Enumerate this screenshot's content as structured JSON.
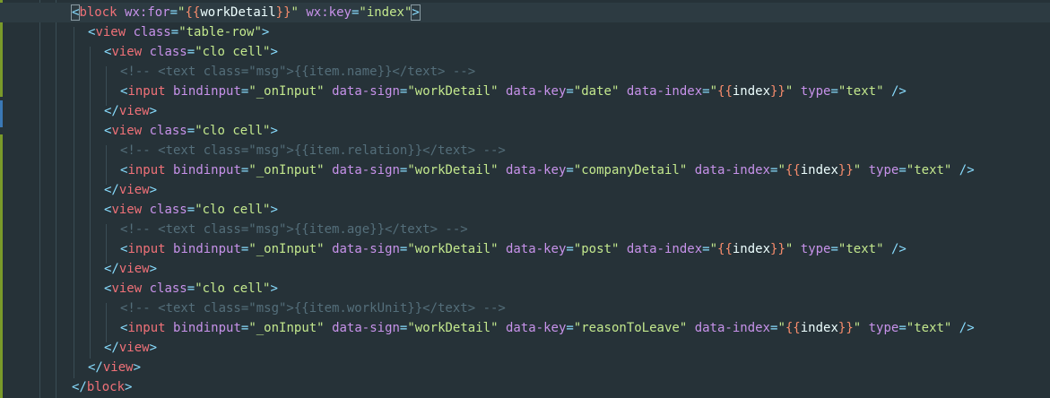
{
  "lines": [
    {
      "indent": 80,
      "active": true,
      "tokens": [
        {
          "t": "<",
          "c": "tk-punc",
          "box": true
        },
        {
          "t": "block",
          "c": "tk-tag"
        },
        {
          "t": " ",
          "c": "tk-text"
        },
        {
          "t": "wx:for",
          "c": "tk-attr"
        },
        {
          "t": "=",
          "c": "tk-eq"
        },
        {
          "t": "\"",
          "c": "tk-str"
        },
        {
          "t": "{{",
          "c": "tk-mus"
        },
        {
          "t": "workDetail",
          "c": "tk-var"
        },
        {
          "t": "}}",
          "c": "tk-mus"
        },
        {
          "t": "\"",
          "c": "tk-str"
        },
        {
          "t": " ",
          "c": "tk-text"
        },
        {
          "t": "wx:key",
          "c": "tk-attr"
        },
        {
          "t": "=",
          "c": "tk-eq"
        },
        {
          "t": "\"index\"",
          "c": "tk-str"
        },
        {
          "t": ">",
          "c": "tk-punc",
          "box": true
        }
      ]
    },
    {
      "indent": 98,
      "tokens": [
        {
          "t": "<",
          "c": "tk-punc"
        },
        {
          "t": "view",
          "c": "tk-tag"
        },
        {
          "t": " ",
          "c": "tk-text"
        },
        {
          "t": "class",
          "c": "tk-attr"
        },
        {
          "t": "=",
          "c": "tk-eq"
        },
        {
          "t": "\"table-row\"",
          "c": "tk-str"
        },
        {
          "t": ">",
          "c": "tk-punc"
        }
      ]
    },
    {
      "indent": 116,
      "tokens": [
        {
          "t": "<",
          "c": "tk-punc"
        },
        {
          "t": "view",
          "c": "tk-tag"
        },
        {
          "t": " ",
          "c": "tk-text"
        },
        {
          "t": "class",
          "c": "tk-attr"
        },
        {
          "t": "=",
          "c": "tk-eq"
        },
        {
          "t": "\"clo cell\"",
          "c": "tk-str"
        },
        {
          "t": ">",
          "c": "tk-punc"
        }
      ]
    },
    {
      "indent": 134,
      "tokens": [
        {
          "t": "<!-- <text class=\"msg\">{{item.name}}</text> -->",
          "c": "tk-cmt"
        }
      ]
    },
    {
      "indent": 134,
      "tokens": [
        {
          "t": "<",
          "c": "tk-punc"
        },
        {
          "t": "input",
          "c": "tk-tag"
        },
        {
          "t": " ",
          "c": "tk-text"
        },
        {
          "t": "bindinput",
          "c": "tk-attr"
        },
        {
          "t": "=",
          "c": "tk-eq"
        },
        {
          "t": "\"_onInput\"",
          "c": "tk-str"
        },
        {
          "t": " ",
          "c": "tk-text"
        },
        {
          "t": "data-sign",
          "c": "tk-attr"
        },
        {
          "t": "=",
          "c": "tk-eq"
        },
        {
          "t": "\"workDetail\"",
          "c": "tk-str"
        },
        {
          "t": " ",
          "c": "tk-text"
        },
        {
          "t": "data-key",
          "c": "tk-attr"
        },
        {
          "t": "=",
          "c": "tk-eq"
        },
        {
          "t": "\"date\"",
          "c": "tk-str"
        },
        {
          "t": " ",
          "c": "tk-text"
        },
        {
          "t": "data-index",
          "c": "tk-attr"
        },
        {
          "t": "=",
          "c": "tk-eq"
        },
        {
          "t": "\"",
          "c": "tk-str"
        },
        {
          "t": "{{",
          "c": "tk-mus"
        },
        {
          "t": "index",
          "c": "tk-var"
        },
        {
          "t": "}}",
          "c": "tk-mus"
        },
        {
          "t": "\"",
          "c": "tk-str"
        },
        {
          "t": " ",
          "c": "tk-text"
        },
        {
          "t": "type",
          "c": "tk-attr"
        },
        {
          "t": "=",
          "c": "tk-eq"
        },
        {
          "t": "\"text\"",
          "c": "tk-str"
        },
        {
          "t": " ",
          "c": "tk-text"
        },
        {
          "t": "/>",
          "c": "tk-punc"
        }
      ]
    },
    {
      "indent": 116,
      "tokens": [
        {
          "t": "</",
          "c": "tk-punc"
        },
        {
          "t": "view",
          "c": "tk-tag"
        },
        {
          "t": ">",
          "c": "tk-punc"
        }
      ]
    },
    {
      "indent": 116,
      "tokens": [
        {
          "t": "<",
          "c": "tk-punc"
        },
        {
          "t": "view",
          "c": "tk-tag"
        },
        {
          "t": " ",
          "c": "tk-text"
        },
        {
          "t": "class",
          "c": "tk-attr"
        },
        {
          "t": "=",
          "c": "tk-eq"
        },
        {
          "t": "\"clo cell\"",
          "c": "tk-str"
        },
        {
          "t": ">",
          "c": "tk-punc"
        }
      ]
    },
    {
      "indent": 134,
      "tokens": [
        {
          "t": "<!-- <text class=\"msg\">{{item.relation}}</text> -->",
          "c": "tk-cmt"
        }
      ]
    },
    {
      "indent": 134,
      "tokens": [
        {
          "t": "<",
          "c": "tk-punc"
        },
        {
          "t": "input",
          "c": "tk-tag"
        },
        {
          "t": " ",
          "c": "tk-text"
        },
        {
          "t": "bindinput",
          "c": "tk-attr"
        },
        {
          "t": "=",
          "c": "tk-eq"
        },
        {
          "t": "\"_onInput\"",
          "c": "tk-str"
        },
        {
          "t": " ",
          "c": "tk-text"
        },
        {
          "t": "data-sign",
          "c": "tk-attr"
        },
        {
          "t": "=",
          "c": "tk-eq"
        },
        {
          "t": "\"workDetail\"",
          "c": "tk-str"
        },
        {
          "t": " ",
          "c": "tk-text"
        },
        {
          "t": "data-key",
          "c": "tk-attr"
        },
        {
          "t": "=",
          "c": "tk-eq"
        },
        {
          "t": "\"companyDetail\"",
          "c": "tk-str"
        },
        {
          "t": " ",
          "c": "tk-text"
        },
        {
          "t": "data-index",
          "c": "tk-attr"
        },
        {
          "t": "=",
          "c": "tk-eq"
        },
        {
          "t": "\"",
          "c": "tk-str"
        },
        {
          "t": "{{",
          "c": "tk-mus"
        },
        {
          "t": "index",
          "c": "tk-var"
        },
        {
          "t": "}}",
          "c": "tk-mus"
        },
        {
          "t": "\"",
          "c": "tk-str"
        },
        {
          "t": " ",
          "c": "tk-text"
        },
        {
          "t": "type",
          "c": "tk-attr"
        },
        {
          "t": "=",
          "c": "tk-eq"
        },
        {
          "t": "\"text\"",
          "c": "tk-str"
        },
        {
          "t": " ",
          "c": "tk-text"
        },
        {
          "t": "/>",
          "c": "tk-punc"
        }
      ]
    },
    {
      "indent": 116,
      "tokens": [
        {
          "t": "</",
          "c": "tk-punc"
        },
        {
          "t": "view",
          "c": "tk-tag"
        },
        {
          "t": ">",
          "c": "tk-punc"
        }
      ]
    },
    {
      "indent": 116,
      "tokens": [
        {
          "t": "<",
          "c": "tk-punc"
        },
        {
          "t": "view",
          "c": "tk-tag"
        },
        {
          "t": " ",
          "c": "tk-text"
        },
        {
          "t": "class",
          "c": "tk-attr"
        },
        {
          "t": "=",
          "c": "tk-eq"
        },
        {
          "t": "\"clo cell\"",
          "c": "tk-str"
        },
        {
          "t": ">",
          "c": "tk-punc"
        }
      ]
    },
    {
      "indent": 134,
      "tokens": [
        {
          "t": "<!-- <text class=\"msg\">{{item.age}}</text> -->",
          "c": "tk-cmt"
        }
      ]
    },
    {
      "indent": 134,
      "tokens": [
        {
          "t": "<",
          "c": "tk-punc"
        },
        {
          "t": "input",
          "c": "tk-tag"
        },
        {
          "t": " ",
          "c": "tk-text"
        },
        {
          "t": "bindinput",
          "c": "tk-attr"
        },
        {
          "t": "=",
          "c": "tk-eq"
        },
        {
          "t": "\"_onInput\"",
          "c": "tk-str"
        },
        {
          "t": " ",
          "c": "tk-text"
        },
        {
          "t": "data-sign",
          "c": "tk-attr"
        },
        {
          "t": "=",
          "c": "tk-eq"
        },
        {
          "t": "\"workDetail\"",
          "c": "tk-str"
        },
        {
          "t": " ",
          "c": "tk-text"
        },
        {
          "t": "data-key",
          "c": "tk-attr"
        },
        {
          "t": "=",
          "c": "tk-eq"
        },
        {
          "t": "\"post\"",
          "c": "tk-str"
        },
        {
          "t": " ",
          "c": "tk-text"
        },
        {
          "t": "data-index",
          "c": "tk-attr"
        },
        {
          "t": "=",
          "c": "tk-eq"
        },
        {
          "t": "\"",
          "c": "tk-str"
        },
        {
          "t": "{{",
          "c": "tk-mus"
        },
        {
          "t": "index",
          "c": "tk-var"
        },
        {
          "t": "}}",
          "c": "tk-mus"
        },
        {
          "t": "\"",
          "c": "tk-str"
        },
        {
          "t": " ",
          "c": "tk-text"
        },
        {
          "t": "type",
          "c": "tk-attr"
        },
        {
          "t": "=",
          "c": "tk-eq"
        },
        {
          "t": "\"text\"",
          "c": "tk-str"
        },
        {
          "t": " ",
          "c": "tk-text"
        },
        {
          "t": "/>",
          "c": "tk-punc"
        }
      ]
    },
    {
      "indent": 116,
      "tokens": [
        {
          "t": "</",
          "c": "tk-punc"
        },
        {
          "t": "view",
          "c": "tk-tag"
        },
        {
          "t": ">",
          "c": "tk-punc"
        }
      ]
    },
    {
      "indent": 116,
      "tokens": [
        {
          "t": "<",
          "c": "tk-punc"
        },
        {
          "t": "view",
          "c": "tk-tag"
        },
        {
          "t": " ",
          "c": "tk-text"
        },
        {
          "t": "class",
          "c": "tk-attr"
        },
        {
          "t": "=",
          "c": "tk-eq"
        },
        {
          "t": "\"clo cell\"",
          "c": "tk-str"
        },
        {
          "t": ">",
          "c": "tk-punc"
        }
      ]
    },
    {
      "indent": 134,
      "tokens": [
        {
          "t": "<!-- <text class=\"msg\">{{item.workUnit}}</text> -->",
          "c": "tk-cmt"
        }
      ]
    },
    {
      "indent": 134,
      "tokens": [
        {
          "t": "<",
          "c": "tk-punc"
        },
        {
          "t": "input",
          "c": "tk-tag"
        },
        {
          "t": " ",
          "c": "tk-text"
        },
        {
          "t": "bindinput",
          "c": "tk-attr"
        },
        {
          "t": "=",
          "c": "tk-eq"
        },
        {
          "t": "\"_onInput\"",
          "c": "tk-str"
        },
        {
          "t": " ",
          "c": "tk-text"
        },
        {
          "t": "data-sign",
          "c": "tk-attr"
        },
        {
          "t": "=",
          "c": "tk-eq"
        },
        {
          "t": "\"workDetail\"",
          "c": "tk-str"
        },
        {
          "t": " ",
          "c": "tk-text"
        },
        {
          "t": "data-key",
          "c": "tk-attr"
        },
        {
          "t": "=",
          "c": "tk-eq"
        },
        {
          "t": "\"reasonToLeave\"",
          "c": "tk-str"
        },
        {
          "t": " ",
          "c": "tk-text"
        },
        {
          "t": "data-index",
          "c": "tk-attr"
        },
        {
          "t": "=",
          "c": "tk-eq"
        },
        {
          "t": "\"",
          "c": "tk-str"
        },
        {
          "t": "{{",
          "c": "tk-mus"
        },
        {
          "t": "index",
          "c": "tk-var"
        },
        {
          "t": "}}",
          "c": "tk-mus"
        },
        {
          "t": "\"",
          "c": "tk-str"
        },
        {
          "t": " ",
          "c": "tk-text"
        },
        {
          "t": "type",
          "c": "tk-attr"
        },
        {
          "t": "=",
          "c": "tk-eq"
        },
        {
          "t": "\"text\"",
          "c": "tk-str"
        },
        {
          "t": " ",
          "c": "tk-text"
        },
        {
          "t": "/>",
          "c": "tk-punc"
        }
      ]
    },
    {
      "indent": 116,
      "tokens": [
        {
          "t": "</",
          "c": "tk-punc"
        },
        {
          "t": "view",
          "c": "tk-tag"
        },
        {
          "t": ">",
          "c": "tk-punc"
        }
      ]
    },
    {
      "indent": 98,
      "tokens": [
        {
          "t": "</",
          "c": "tk-punc"
        },
        {
          "t": "view",
          "c": "tk-tag"
        },
        {
          "t": ">",
          "c": "tk-punc"
        }
      ]
    },
    {
      "indent": 80,
      "tokens": [
        {
          "t": "</",
          "c": "tk-punc"
        },
        {
          "t": "block",
          "c": "tk-tag"
        },
        {
          "t": ">",
          "c": "tk-punc"
        }
      ]
    }
  ],
  "colors": {
    "background": "#263238",
    "active_line": "#2d3b42",
    "tag": "#f07178",
    "attribute": "#c792ea",
    "string": "#c3e88d",
    "punctuation": "#89ddff",
    "mustache": "#f78c6c",
    "comment": "#546e7a",
    "git_added": "#7a9a2a",
    "git_modified": "#3a78b5"
  }
}
